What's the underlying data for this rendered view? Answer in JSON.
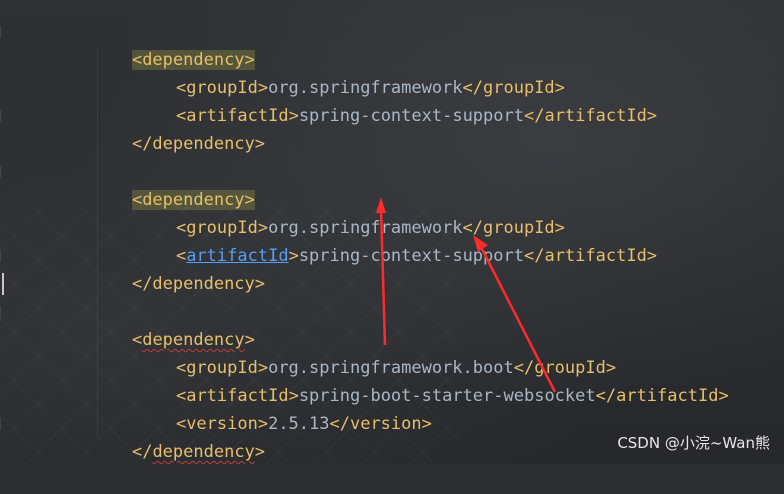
{
  "watermark": "CSDN @小浣~Wan熊",
  "blocks": [
    {
      "open": "<dependency>",
      "groupId_open": "<groupId>",
      "groupId_value": "org.springframework",
      "groupId_close": "</groupId>",
      "artifactId_open_lt": "<",
      "artifactId_tag": "artifactId",
      "artifactId_open_gt": ">",
      "artifactId_value": "spring-context-support",
      "artifactId_close": "</artifactId>",
      "close": "</dependency>"
    },
    {
      "open": "<dependency>",
      "groupId_open": "<groupId>",
      "groupId_value": "org.springframework",
      "groupId_close": "</groupId>",
      "artifactId_open_lt": "<",
      "artifactId_tag": "artifactId",
      "artifactId_open_gt": ">",
      "artifactId_value": "spring-context-support",
      "artifactId_close": "</artifactId>",
      "close": "</dependency>"
    },
    {
      "open_lt": "<",
      "open_tag": "dependency",
      "open_gt": ">",
      "groupId_open": "<groupId>",
      "groupId_value": "org.springframework.boot",
      "groupId_close_a": "</",
      "groupId_close_tag": "groupId",
      "groupId_close_b": ">",
      "artifactId_open_lt": "<",
      "artifactId_tag": "artifactId",
      "artifactId_open_gt": ">",
      "artifactId_value": "spring-boot-starter-websocket",
      "artifactId_close": "</artifactId>",
      "version_open": "<version>",
      "version_value": "2.5.13",
      "version_close": "</version>",
      "close_lt": "</",
      "close_tag": "dependency",
      "close_gt": ">"
    }
  ]
}
